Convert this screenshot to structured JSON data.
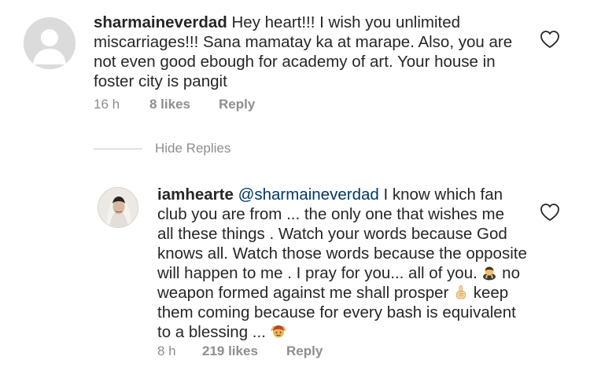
{
  "comments": [
    {
      "username": "sharmaineverdad",
      "text": "Hey heart!!! I wish you unlimited\nmiscarriages!!! Sana mamatay ka at marape. Also, you are\nnot even good ebough for academy of art. Your house in\nfoster city is pangit",
      "time": "16 h",
      "likes": "8 likes",
      "reply_label": "Reply"
    },
    {
      "username": "iamhearte",
      "mention": "@sharmaineverdad",
      "text_part1": "I know which fan\nclub you are from ... the only one that wishes me\nall these things . Watch your words because God\nknows all. Watch those words because the opposite\nwill happen to me . I pray for you... all of you. ",
      "text_part2": " no\nweapon formed against me shall prosper ",
      "text_part3": " keep\nthem coming because for every bash is equivalent\nto a blessing ... ",
      "time": "8 h",
      "likes": "219 likes",
      "reply_label": "Reply"
    }
  ],
  "hide_replies_label": "Hide Replies",
  "icons": {
    "like": "heart-outline-icon",
    "avatar_default": "default-user-avatar",
    "emoji_1": "person-bowing-emoji",
    "emoji_2": "pointing-up-hand-emoji",
    "emoji_3": "person-gesturing-emoji"
  },
  "colors": {
    "text": "#262626",
    "secondary": "#8e8e8e",
    "mention": "#00376b"
  }
}
